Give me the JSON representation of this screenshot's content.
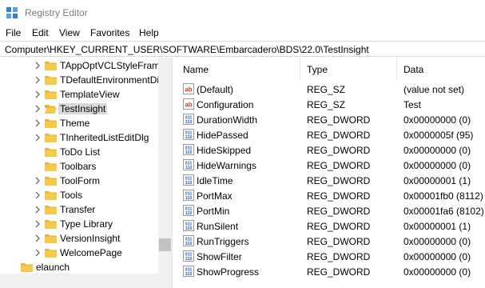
{
  "window": {
    "title": "Registry Editor"
  },
  "menu": [
    "File",
    "Edit",
    "View",
    "Favorites",
    "Help"
  ],
  "address": "Computer\\HKEY_CURRENT_USER\\SOFTWARE\\Embarcadero\\BDS\\22.0\\TestInsight",
  "tree": {
    "items": [
      {
        "label": "TAppOptVCLStyleFrame",
        "selected": false
      },
      {
        "label": "TDefaultEnvironmentDi",
        "selected": false
      },
      {
        "label": "TemplateView",
        "selected": false
      },
      {
        "label": "TestInsight",
        "selected": true
      },
      {
        "label": "Theme",
        "selected": false
      },
      {
        "label": "TInheritedListEditDlg",
        "selected": false
      },
      {
        "label": "ToDo List",
        "selected": false
      },
      {
        "label": "Toolbars",
        "selected": false
      },
      {
        "label": "ToolForm",
        "selected": false
      },
      {
        "label": "Tools",
        "selected": false
      },
      {
        "label": "Transfer",
        "selected": false
      },
      {
        "label": "Type Library",
        "selected": false
      },
      {
        "label": "VersionInsight",
        "selected": false
      },
      {
        "label": "WelcomePage",
        "selected": false
      }
    ],
    "root_item": "elaunch"
  },
  "list": {
    "headers": {
      "name": "Name",
      "type": "Type",
      "data": "Data"
    },
    "rows": [
      {
        "icon": "string-value-icon",
        "name": "(Default)",
        "type": "REG_SZ",
        "data": "(value not set)"
      },
      {
        "icon": "string-value-icon",
        "name": "Configuration",
        "type": "REG_SZ",
        "data": "Test"
      },
      {
        "icon": "binary-value-icon",
        "name": "DurationWidth",
        "type": "REG_DWORD",
        "data": "0x00000000 (0)"
      },
      {
        "icon": "binary-value-icon",
        "name": "HidePassed",
        "type": "REG_DWORD",
        "data": "0x0000005f (95)"
      },
      {
        "icon": "binary-value-icon",
        "name": "HideSkipped",
        "type": "REG_DWORD",
        "data": "0x00000000 (0)"
      },
      {
        "icon": "binary-value-icon",
        "name": "HideWarnings",
        "type": "REG_DWORD",
        "data": "0x00000000 (0)"
      },
      {
        "icon": "binary-value-icon",
        "name": "IdleTime",
        "type": "REG_DWORD",
        "data": "0x00000001 (1)"
      },
      {
        "icon": "binary-value-icon",
        "name": "PortMax",
        "type": "REG_DWORD",
        "data": "0x00001fb0 (8112)"
      },
      {
        "icon": "binary-value-icon",
        "name": "PortMin",
        "type": "REG_DWORD",
        "data": "0x00001fa6 (8102)"
      },
      {
        "icon": "binary-value-icon",
        "name": "RunSilent",
        "type": "REG_DWORD",
        "data": "0x00000001 (1)"
      },
      {
        "icon": "binary-value-icon",
        "name": "RunTriggers",
        "type": "REG_DWORD",
        "data": "0x00000000 (0)"
      },
      {
        "icon": "binary-value-icon",
        "name": "ShowFilter",
        "type": "REG_DWORD",
        "data": "0x00000000 (0)"
      },
      {
        "icon": "binary-value-icon",
        "name": "ShowProgress",
        "type": "REG_DWORD",
        "data": "0x00000000 (0)"
      }
    ]
  },
  "colors": {
    "folder": "#e8b339",
    "selection": "#d9d9d9",
    "string_icon": "#c8392b",
    "binary_icon": "#2b5fb3"
  }
}
